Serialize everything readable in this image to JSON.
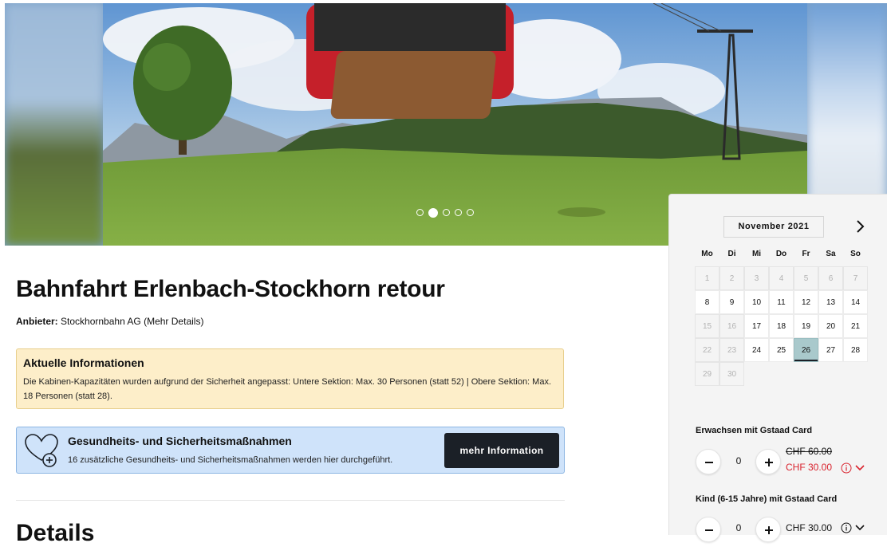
{
  "colors": {
    "accent_dark": "#1b2027",
    "discount_red": "#d9232e",
    "info_bg": "#fdeec9",
    "health_bg": "#cfe3fa",
    "selected_day": "#a9c9cc"
  },
  "carousel": {
    "slide_count": 5,
    "active_slide": 2,
    "image_description": "Rote Gondel Stockhorn über grüner Wiese"
  },
  "product": {
    "title": "Bahnfahrt Erlenbach-Stockhorn retour",
    "provider_label": "Anbieter:",
    "provider_name": "Stockhornbahn AG",
    "provider_link": "(Mehr Details)"
  },
  "info": {
    "title": "Aktuelle Informationen",
    "text": "Die Kabinen-Kapazitäten wurden aufgrund der Sicherheit angepasst: Untere Sektion: Max. 30 Personen (statt 52) | Obere Sektion: Max. 18 Personen (statt 28)."
  },
  "health": {
    "icon": "heart-plus-icon",
    "title": "Gesundheits- und Sicherheitsmaßnahmen",
    "text": "16 zusätzliche Gesundheits- und Sicherheitsmaßnahmen werden hier durchgeführt.",
    "button": "mehr Information"
  },
  "details_heading": "Details",
  "calendar": {
    "month": "November 2021",
    "next_icon": "chevron-right-icon",
    "weekdays": [
      "Mo",
      "Di",
      "Mi",
      "Do",
      "Fr",
      "Sa",
      "So"
    ],
    "days": [
      {
        "d": "1",
        "s": "na"
      },
      {
        "d": "2",
        "s": "na"
      },
      {
        "d": "3",
        "s": "na"
      },
      {
        "d": "4",
        "s": "na"
      },
      {
        "d": "5",
        "s": "na"
      },
      {
        "d": "6",
        "s": "na"
      },
      {
        "d": "7",
        "s": "na"
      },
      {
        "d": "8",
        "s": "av"
      },
      {
        "d": "9",
        "s": "av"
      },
      {
        "d": "10",
        "s": "av"
      },
      {
        "d": "11",
        "s": "av"
      },
      {
        "d": "12",
        "s": "av"
      },
      {
        "d": "13",
        "s": "av"
      },
      {
        "d": "14",
        "s": "av"
      },
      {
        "d": "15",
        "s": "na"
      },
      {
        "d": "16",
        "s": "na"
      },
      {
        "d": "17",
        "s": "av"
      },
      {
        "d": "18",
        "s": "av"
      },
      {
        "d": "19",
        "s": "av"
      },
      {
        "d": "20",
        "s": "av"
      },
      {
        "d": "21",
        "s": "av"
      },
      {
        "d": "22",
        "s": "na"
      },
      {
        "d": "23",
        "s": "na"
      },
      {
        "d": "24",
        "s": "av"
      },
      {
        "d": "25",
        "s": "av"
      },
      {
        "d": "26",
        "s": "sel"
      },
      {
        "d": "27",
        "s": "av"
      },
      {
        "d": "28",
        "s": "av"
      },
      {
        "d": "29",
        "s": "na"
      },
      {
        "d": "30",
        "s": "na"
      }
    ],
    "selected": "26"
  },
  "tickets": [
    {
      "label": "Erwachsen mit Gstaad Card",
      "quantity": "0",
      "old_price": "CHF 60.00",
      "price": "CHF 30.00"
    },
    {
      "label": "Kind (6-15 Jahre) mit Gstaad Card",
      "quantity": "0",
      "price": "CHF 30.00"
    }
  ]
}
